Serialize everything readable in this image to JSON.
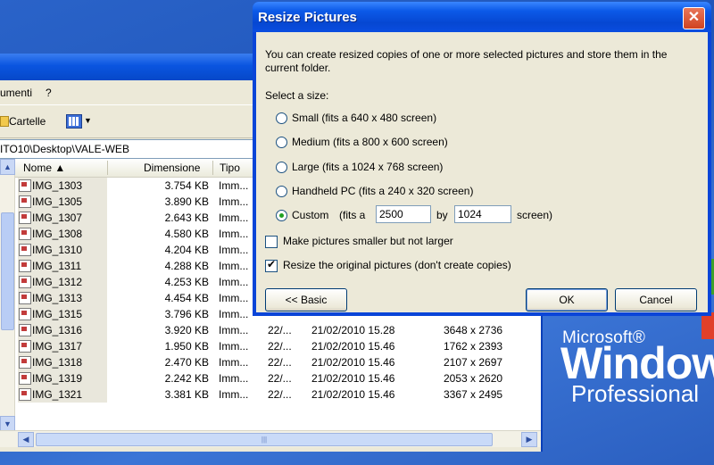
{
  "desktop": {
    "watermark_microsoft": "Microsoft®",
    "watermark_windows": "Windows",
    "watermark_professional": "Professional"
  },
  "explorer": {
    "menu_fragment": "umenti",
    "menu_help": "?",
    "toolbar_folders": "Cartelle",
    "address": "ITO10\\Desktop\\VALE-WEB",
    "columns": {
      "name": "Nome ▲",
      "size": "Dimensione",
      "type": "Tipo"
    },
    "files": [
      {
        "name": "IMG_1303",
        "size": "3.754 KB",
        "type": "Imm...",
        "dtype": "",
        "date": "",
        "dims": ""
      },
      {
        "name": "IMG_1305",
        "size": "3.890 KB",
        "type": "Imm...",
        "dtype": "",
        "date": "",
        "dims": ""
      },
      {
        "name": "IMG_1307",
        "size": "2.643 KB",
        "type": "Imm...",
        "dtype": "",
        "date": "",
        "dims": ""
      },
      {
        "name": "IMG_1308",
        "size": "4.580 KB",
        "type": "Imm...",
        "dtype": "",
        "date": "",
        "dims": ""
      },
      {
        "name": "IMG_1310",
        "size": "4.204 KB",
        "type": "Imm...",
        "dtype": "",
        "date": "",
        "dims": ""
      },
      {
        "name": "IMG_1311",
        "size": "4.288 KB",
        "type": "Imm...",
        "dtype": "",
        "date": "",
        "dims": ""
      },
      {
        "name": "IMG_1312",
        "size": "4.253 KB",
        "type": "Imm...",
        "dtype": "",
        "date": "",
        "dims": ""
      },
      {
        "name": "IMG_1313",
        "size": "4.454 KB",
        "type": "Imm...",
        "dtype": "",
        "date": "",
        "dims": ""
      },
      {
        "name": "IMG_1315",
        "size": "3.796 KB",
        "type": "Imm...",
        "dtype": "",
        "date": "",
        "dims": ""
      },
      {
        "name": "IMG_1316",
        "size": "3.920 KB",
        "type": "Imm...",
        "dtype": "22/...",
        "date": "21/02/2010 15.28",
        "dims": "3648 x 2736"
      },
      {
        "name": "IMG_1317",
        "size": "1.950 KB",
        "type": "Imm...",
        "dtype": "22/...",
        "date": "21/02/2010 15.46",
        "dims": "1762 x 2393"
      },
      {
        "name": "IMG_1318",
        "size": "2.470 KB",
        "type": "Imm...",
        "dtype": "22/...",
        "date": "21/02/2010 15.46",
        "dims": "2107 x 2697"
      },
      {
        "name": "IMG_1319",
        "size": "2.242 KB",
        "type": "Imm...",
        "dtype": "22/...",
        "date": "21/02/2010 15.46",
        "dims": "2053 x 2620"
      },
      {
        "name": "IMG_1321",
        "size": "3.381 KB",
        "type": "Imm...",
        "dtype": "22/...",
        "date": "21/02/2010 15.46",
        "dims": "3367 x 2495"
      }
    ]
  },
  "dialog": {
    "title": "Resize Pictures",
    "description": "You can create resized copies of one or more selected pictures and store them in the current folder.",
    "select_label": "Select a size:",
    "options": [
      {
        "label": "Small (fits a 640 x 480 screen)",
        "selected": false
      },
      {
        "label": "Medium (fits a 800 x 600 screen)",
        "selected": false
      },
      {
        "label": "Large (fits a 1024 x 768 screen)",
        "selected": false
      },
      {
        "label": "Handheld PC (fits a 240 x 320 screen)",
        "selected": false
      }
    ],
    "custom": {
      "label": "Custom",
      "fits_a": "(fits a",
      "width": "2500",
      "by": "by",
      "height": "1024",
      "screen": "screen)",
      "selected": true
    },
    "checkboxes": [
      {
        "label": "Make pictures smaller but not larger",
        "checked": false
      },
      {
        "label": "Resize the original pictures (don't create copies)",
        "checked": true
      }
    ],
    "basic_button": "<< Basic",
    "ok_button": "OK",
    "cancel_button": "Cancel"
  }
}
